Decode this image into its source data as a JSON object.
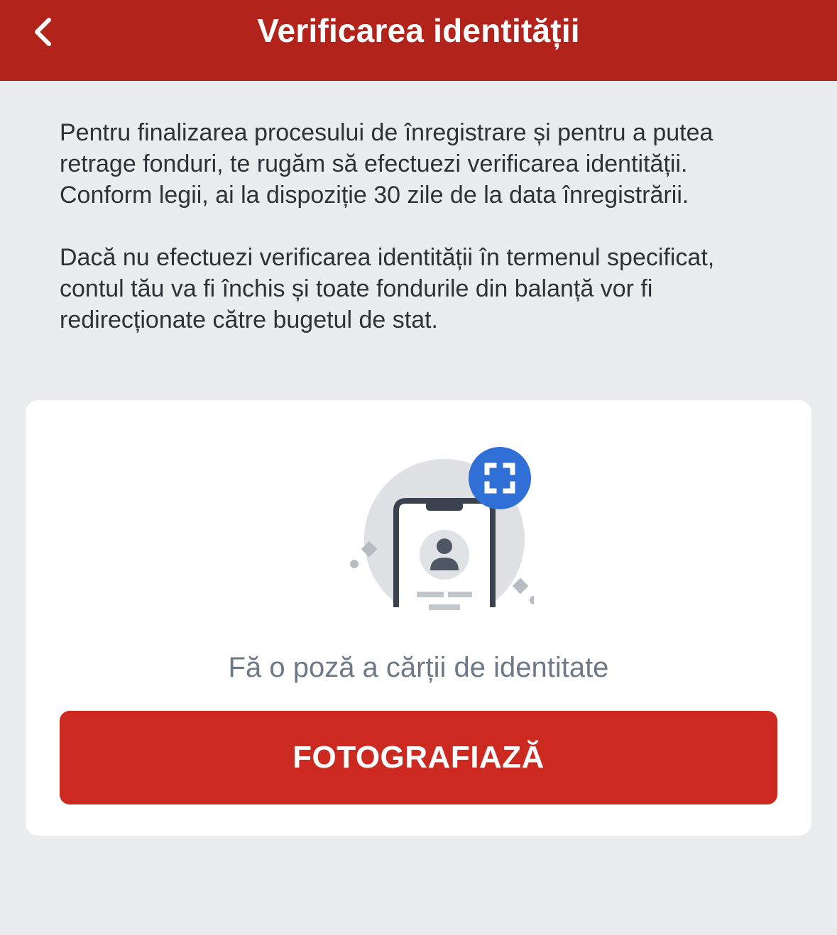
{
  "header": {
    "back_icon": "chevron-left-icon",
    "title": "Verificarea identității"
  },
  "intro": {
    "paragraph1": "Pentru finalizarea procesului de înregistrare și pentru a putea retrage fonduri, te rugăm să efectuezi verificarea identității. Conform legii, ai la dispoziție 30 zile de la data înregistrării.",
    "paragraph2": "Dacă nu efectuezi verificarea identității în termenul specificat, contul tău va fi închis și toate fondurile din balanță vor fi redirecționate către bugetul de stat."
  },
  "card": {
    "illustration_icon": "phone-id-scan-icon",
    "caption": "Fă o poză a cărții de identitate",
    "button_label": "FOTOGRAFIAZĂ"
  },
  "colors": {
    "header_bg": "#b2241b",
    "button_bg": "#cc2a20",
    "page_bg": "#ebecee",
    "scan_badge": "#2f6fd6"
  }
}
